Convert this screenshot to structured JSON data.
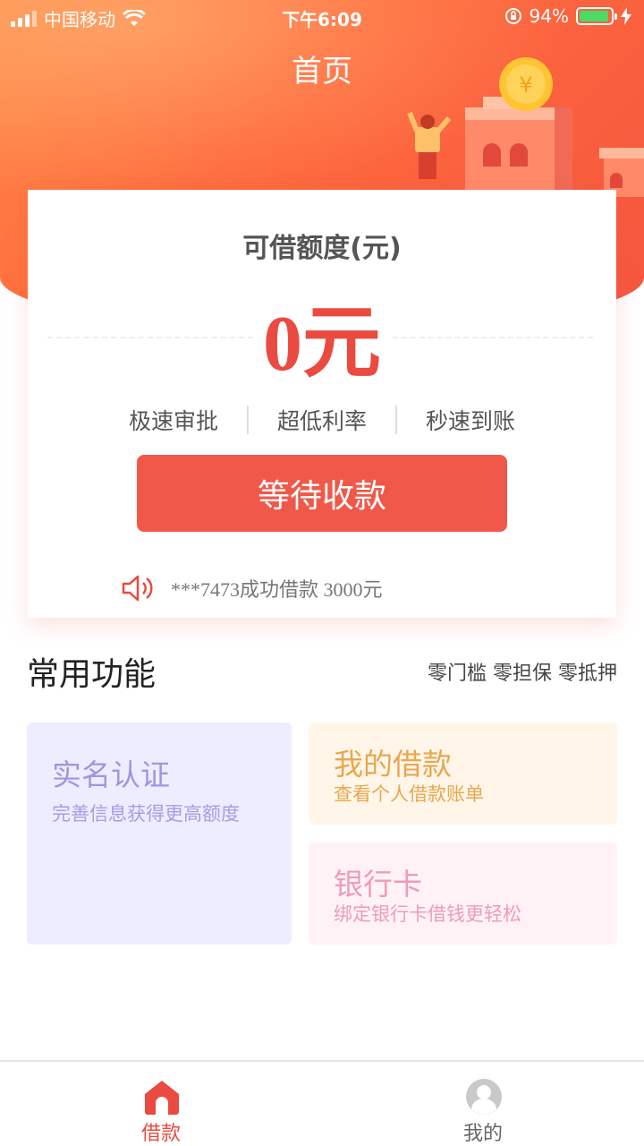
{
  "status_bar": {
    "carrier": "中国移动",
    "time": "下午6:09",
    "battery": "94%",
    "battery_level": 0.94
  },
  "header": {
    "title": "首页"
  },
  "credit": {
    "title": "可借额度(元)",
    "amount": "0元",
    "features": [
      "极速审批",
      "超低利率",
      "秒速到账"
    ],
    "button_label": "等待收款",
    "notice": "***7473成功借款 3000元"
  },
  "section": {
    "title": "常用功能",
    "slogan": "零门槛 零担保 零抵押"
  },
  "tiles": {
    "verify": {
      "title": "实名认证",
      "subtitle": "完善信息获得更高额度"
    },
    "loans": {
      "title": "我的借款",
      "subtitle": "查看个人借款账单"
    },
    "card": {
      "title": "银行卡",
      "subtitle": "绑定银行卡借钱更轻松"
    }
  },
  "tab_bar": {
    "items": [
      {
        "label": "借款",
        "icon": "home-icon",
        "active": true
      },
      {
        "label": "我的",
        "icon": "user-avatar-icon",
        "active": false
      }
    ]
  },
  "colors": {
    "accent": "#f0594a",
    "amount": "#ea4a3f",
    "verify_tile": "#eeedff",
    "loans_tile": "#fff6e9",
    "card_tile": "#fff2f6"
  }
}
